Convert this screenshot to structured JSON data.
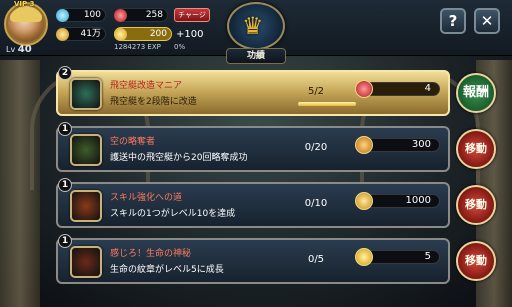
{
  "player": {
    "vip": "VIP 3",
    "level_prefix": "Lv",
    "level": "40",
    "exp": "1284273 EXP",
    "exp_percent": "0%",
    "exp_fraction": 0.0
  },
  "resources": {
    "gems": "100",
    "rubies": "258",
    "gold": "41万",
    "stamina": "200",
    "stamina_plus": "+100",
    "charge_label": "チャージ"
  },
  "header": {
    "title": "功績",
    "help_label": "?",
    "close_label": "✕"
  },
  "achievements": [
    {
      "badge": "2",
      "title": "飛空艇改造マニア",
      "description": "飛空艇を2段階に改造",
      "progress": "5/2",
      "progress_fraction": 1.0,
      "reward_value": "4",
      "reward_icon": "ruby-icon",
      "action_label": "報酬",
      "state": "claimable"
    },
    {
      "badge": "1",
      "title": "空の略奪者",
      "description": "護送中の飛空艇から20回略奪成功",
      "progress": "0/20",
      "progress_fraction": 0.0,
      "reward_value": "300",
      "reward_icon": "sp-icon",
      "action_label": "移動",
      "state": "in-progress"
    },
    {
      "badge": "1",
      "title": "スキル強化への道",
      "description": "スキルの1つがレベル10を達成",
      "progress": "0/10",
      "progress_fraction": 0.0,
      "reward_value": "1000",
      "reward_icon": "gold-coin-icon",
      "action_label": "移動",
      "state": "in-progress"
    },
    {
      "badge": "1",
      "title": "感じろ！生命の神秘",
      "description": "生命の紋章がレベル5に成長",
      "progress": "0/5",
      "progress_fraction": 0.0,
      "reward_value": "5",
      "reward_icon": "lightning-icon",
      "action_label": "移動",
      "state": "in-progress"
    }
  ],
  "colors": {
    "active_row": "#e0c777",
    "row": "#22303f",
    "claim_button": "#2f7a3e",
    "move_button": "#b42e24",
    "title_text": "#ff7a5c"
  }
}
